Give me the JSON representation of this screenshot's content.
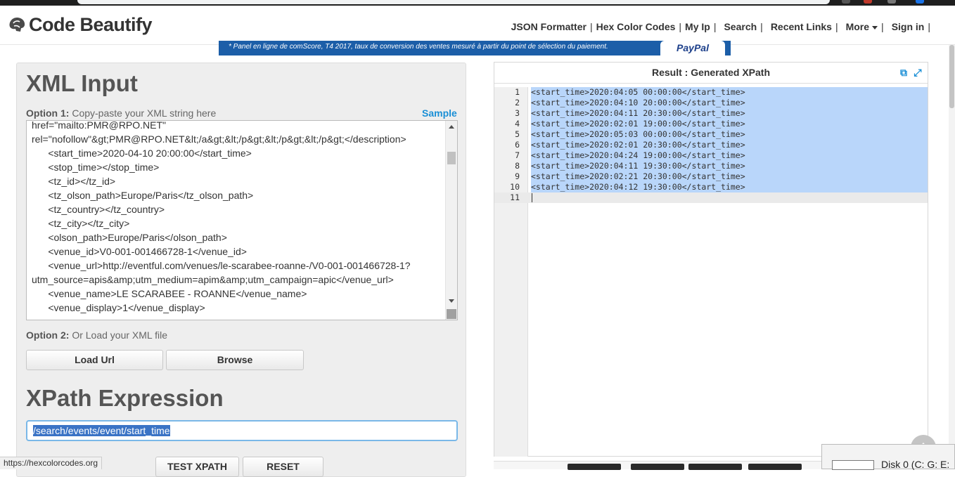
{
  "header": {
    "logo_text": "Code Beautify",
    "nav": [
      {
        "label": "JSON Formatter"
      },
      {
        "label": "Hex Color Codes"
      },
      {
        "label": "My Ip"
      },
      {
        "label": "Search"
      },
      {
        "label": "Recent Links"
      },
      {
        "label": "More"
      },
      {
        "label": "Sign in"
      }
    ]
  },
  "ad": {
    "text": "* Panel en ligne de comScore, T4 2017, taux de conversion des ventes mesuré à partir du point de sélection du paiement.",
    "brand": "PayPal"
  },
  "left": {
    "title": "XML Input",
    "option1_bold": "Option 1:",
    "option1_text": "Copy-paste your XML string here",
    "sample_label": "Sample",
    "xml_lines": [
      "href=\"mailto:PMR@RPO.NET\"",
      "rel=\"nofollow\"&gt;PMR@RPO.NET&lt;/a&gt;&lt;/p&gt;&lt;/p&gt;&lt;/p&gt;</description>",
      "      <start_time>2020-04-10 20:00:00</start_time>",
      "      <stop_time></stop_time>",
      "      <tz_id></tz_id>",
      "      <tz_olson_path>Europe/Paris</tz_olson_path>",
      "      <tz_country></tz_country>",
      "      <tz_city></tz_city>",
      "      <olson_path>Europe/Paris</olson_path>",
      "      <venue_id>V0-001-001466728-1</venue_id>",
      "      <venue_url>http://eventful.com/venues/le-scarabee-roanne-/V0-001-001466728-1?",
      "utm_source=apis&amp;utm_medium=apim&amp;utm_campaign=apic</venue_url>",
      "      <venue_name>LE SCARABEE - ROANNE</venue_name>",
      "      <venue_display>1</venue_display>"
    ],
    "option2_bold": "Option 2:",
    "option2_text": "Or Load your XML file",
    "load_url_label": "Load Url",
    "browse_label": "Browse",
    "xpath_title": "XPath Expression",
    "xpath_value": "/search/events/event/start_time",
    "test_label": "TEST XPATH",
    "reset_label": "RESET"
  },
  "right": {
    "title": "Result : Generated XPath",
    "lines": [
      {
        "n": "1",
        "text": "<start_time>2020:04:05 00:00:00</start_time>"
      },
      {
        "n": "2",
        "text": "<start_time>2020:04:10 20:00:00</start_time>"
      },
      {
        "n": "3",
        "text": "<start_time>2020:04:11 20:30:00</start_time>"
      },
      {
        "n": "4",
        "text": "<start_time>2020:02:01 19:00:00</start_time>"
      },
      {
        "n": "5",
        "text": "<start_time>2020:05:03 00:00:00</start_time>"
      },
      {
        "n": "6",
        "text": "<start_time>2020:02:01 20:30:00</start_time>"
      },
      {
        "n": "7",
        "text": "<start_time>2020:04:24 19:00:00</start_time>"
      },
      {
        "n": "8",
        "text": "<start_time>2020:04:11 19:30:00</start_time>"
      },
      {
        "n": "9",
        "text": "<start_time>2020:02:21 20:30:00</start_time>"
      },
      {
        "n": "10",
        "text": "<start_time>2020:04:12 19:30:00</start_time>"
      },
      {
        "n": "11",
        "text": ""
      }
    ]
  },
  "status_url": "https://hexcolorcodes.org",
  "disk_label": "Disk 0 (C: G: E:",
  "colors": {
    "accent": "#1a8fd6",
    "selection": "#b9d6fa",
    "ad_bg": "#1c5ea8"
  }
}
